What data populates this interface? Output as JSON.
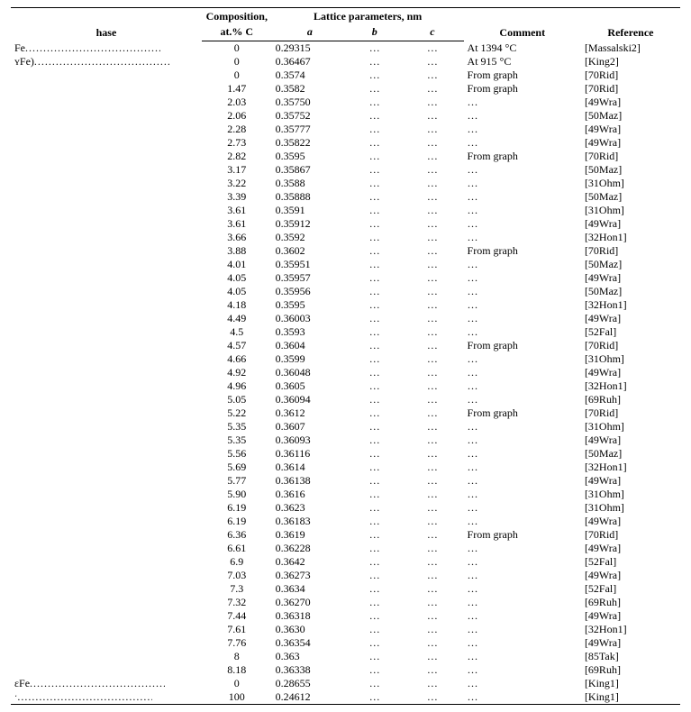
{
  "headers": {
    "phase": "hase",
    "composition_top": "Composition,",
    "composition_bot": "at.% C",
    "lattice": "Lattice parameters, nm",
    "a": "a",
    "b": "b",
    "c": "c",
    "comment": "Comment",
    "reference": "Reference"
  },
  "chart_data": {
    "type": "table",
    "columns": [
      "Phase",
      "Composition, at.% C",
      "a (nm)",
      "b (nm)",
      "c (nm)",
      "Comment",
      "Reference"
    ]
  },
  "rows": [
    {
      "phase": "Fe",
      "comp": "0",
      "a": "0.29315",
      "b": "…",
      "c": "…",
      "comment": "At 1394 °C",
      "ref": "[Massalski2]"
    },
    {
      "phase": "ʏFe)",
      "comp": "0",
      "a": "0.36467",
      "b": "…",
      "c": "…",
      "comment": "At 915 °C",
      "ref": "[King2]"
    },
    {
      "phase": "",
      "comp": "0",
      "a": "0.3574",
      "b": "…",
      "c": "…",
      "comment": "From graph",
      "ref": "[70Rid]"
    },
    {
      "phase": "",
      "comp": "1.47",
      "a": "0.3582",
      "b": "…",
      "c": "…",
      "comment": "From graph",
      "ref": "[70Rid]"
    },
    {
      "phase": "",
      "comp": "2.03",
      "a": "0.35750",
      "b": "…",
      "c": "…",
      "comment": "…",
      "ref": "[49Wra]"
    },
    {
      "phase": "",
      "comp": "2.06",
      "a": "0.35752",
      "b": "…",
      "c": "…",
      "comment": "…",
      "ref": "[50Maz]"
    },
    {
      "phase": "",
      "comp": "2.28",
      "a": "0.35777",
      "b": "…",
      "c": "…",
      "comment": "…",
      "ref": "[49Wra]"
    },
    {
      "phase": "",
      "comp": "2.73",
      "a": "0.35822",
      "b": "…",
      "c": "…",
      "comment": "…",
      "ref": "[49Wra]"
    },
    {
      "phase": "",
      "comp": "2.82",
      "a": "0.3595",
      "b": "…",
      "c": "…",
      "comment": "From graph",
      "ref": "[70Rid]"
    },
    {
      "phase": "",
      "comp": "3.17",
      "a": "0.35867",
      "b": "…",
      "c": "…",
      "comment": "…",
      "ref": "[50Maz]"
    },
    {
      "phase": "",
      "comp": "3.22",
      "a": "0.3588",
      "b": "…",
      "c": "…",
      "comment": "…",
      "ref": "[31Ohm]"
    },
    {
      "phase": "",
      "comp": "3.39",
      "a": "0.35888",
      "b": "…",
      "c": "…",
      "comment": "…",
      "ref": "[50Maz]"
    },
    {
      "phase": "",
      "comp": "3.61",
      "a": "0.3591",
      "b": "…",
      "c": "…",
      "comment": "…",
      "ref": "[31Ohm]"
    },
    {
      "phase": "",
      "comp": "3.61",
      "a": "0.35912",
      "b": "…",
      "c": "…",
      "comment": "…",
      "ref": "[49Wra]"
    },
    {
      "phase": "",
      "comp": "3.66",
      "a": "0.3592",
      "b": "…",
      "c": "…",
      "comment": "…",
      "ref": "[32Hon1]"
    },
    {
      "phase": "",
      "comp": "3.88",
      "a": "0.3602",
      "b": "…",
      "c": "…",
      "comment": "From graph",
      "ref": "[70Rid]"
    },
    {
      "phase": "",
      "comp": "4.01",
      "a": "0.35951",
      "b": "…",
      "c": "…",
      "comment": "…",
      "ref": "[50Maz]"
    },
    {
      "phase": "",
      "comp": "4.05",
      "a": "0.35957",
      "b": "…",
      "c": "…",
      "comment": "…",
      "ref": "[49Wra]"
    },
    {
      "phase": "",
      "comp": "4.05",
      "a": "0.35956",
      "b": "…",
      "c": "…",
      "comment": "…",
      "ref": "[50Maz]"
    },
    {
      "phase": "",
      "comp": "4.18",
      "a": "0.3595",
      "b": "…",
      "c": "…",
      "comment": "…",
      "ref": "[32Hon1]"
    },
    {
      "phase": "",
      "comp": "4.49",
      "a": "0.36003",
      "b": "…",
      "c": "…",
      "comment": "…",
      "ref": "[49Wra]"
    },
    {
      "phase": "",
      "comp": "4.5",
      "a": "0.3593",
      "b": "…",
      "c": "…",
      "comment": "…",
      "ref": "[52Fal]"
    },
    {
      "phase": "",
      "comp": "4.57",
      "a": "0.3604",
      "b": "…",
      "c": "…",
      "comment": "From graph",
      "ref": "[70Rid]"
    },
    {
      "phase": "",
      "comp": "4.66",
      "a": "0.3599",
      "b": "…",
      "c": "…",
      "comment": "…",
      "ref": "[31Ohm]"
    },
    {
      "phase": "",
      "comp": "4.92",
      "a": "0.36048",
      "b": "…",
      "c": "…",
      "comment": "…",
      "ref": "[49Wra]"
    },
    {
      "phase": "",
      "comp": "4.96",
      "a": "0.3605",
      "b": "…",
      "c": "…",
      "comment": "…",
      "ref": "[32Hon1]"
    },
    {
      "phase": "",
      "comp": "5.05",
      "a": "0.36094",
      "b": "…",
      "c": "…",
      "comment": "…",
      "ref": "[69Ruh]"
    },
    {
      "phase": "",
      "comp": "5.22",
      "a": "0.3612",
      "b": "…",
      "c": "…",
      "comment": "From graph",
      "ref": "[70Rid]"
    },
    {
      "phase": "",
      "comp": "5.35",
      "a": "0.3607",
      "b": "…",
      "c": "…",
      "comment": "…",
      "ref": "[31Ohm]"
    },
    {
      "phase": "",
      "comp": "5.35",
      "a": "0.36093",
      "b": "…",
      "c": "…",
      "comment": "…",
      "ref": "[49Wra]"
    },
    {
      "phase": "",
      "comp": "5.56",
      "a": "0.36116",
      "b": "…",
      "c": "…",
      "comment": "…",
      "ref": "[50Maz]"
    },
    {
      "phase": "",
      "comp": "5.69",
      "a": "0.3614",
      "b": "…",
      "c": "…",
      "comment": "…",
      "ref": "[32Hon1]"
    },
    {
      "phase": "",
      "comp": "5.77",
      "a": "0.36138",
      "b": "…",
      "c": "…",
      "comment": "…",
      "ref": "[49Wra]"
    },
    {
      "phase": "",
      "comp": "5.90",
      "a": "0.3616",
      "b": "…",
      "c": "…",
      "comment": "…",
      "ref": "[31Ohm]"
    },
    {
      "phase": "",
      "comp": "6.19",
      "a": "0.3623",
      "b": "…",
      "c": "…",
      "comment": "…",
      "ref": "[31Ohm]"
    },
    {
      "phase": "",
      "comp": "6.19",
      "a": "0.36183",
      "b": "…",
      "c": "…",
      "comment": "…",
      "ref": "[49Wra]"
    },
    {
      "phase": "",
      "comp": "6.36",
      "a": "0.3619",
      "b": "…",
      "c": "…",
      "comment": "From graph",
      "ref": "[70Rid]"
    },
    {
      "phase": "",
      "comp": "6.61",
      "a": "0.36228",
      "b": "…",
      "c": "…",
      "comment": "…",
      "ref": "[49Wra]"
    },
    {
      "phase": "",
      "comp": "6.9",
      "a": "0.3642",
      "b": "…",
      "c": "…",
      "comment": "…",
      "ref": "[52Fal]"
    },
    {
      "phase": "",
      "comp": "7.03",
      "a": "0.36273",
      "b": "…",
      "c": "…",
      "comment": "…",
      "ref": "[49Wra]"
    },
    {
      "phase": "",
      "comp": "7.3",
      "a": "0.3634",
      "b": "…",
      "c": "…",
      "comment": "…",
      "ref": "[52Fal]"
    },
    {
      "phase": "",
      "comp": "7.32",
      "a": "0.36270",
      "b": "…",
      "c": "…",
      "comment": "…",
      "ref": "[69Ruh]"
    },
    {
      "phase": "",
      "comp": "7.44",
      "a": "0.36318",
      "b": "…",
      "c": "…",
      "comment": "…",
      "ref": "[49Wra]"
    },
    {
      "phase": "",
      "comp": "7.61",
      "a": "0.3630",
      "b": "…",
      "c": "…",
      "comment": "…",
      "ref": "[32Hon1]"
    },
    {
      "phase": "",
      "comp": "7.76",
      "a": "0.36354",
      "b": "…",
      "c": "…",
      "comment": "…",
      "ref": "[49Wra]"
    },
    {
      "phase": "",
      "comp": "8",
      "a": "0.363",
      "b": "…",
      "c": "…",
      "comment": "…",
      "ref": "[85Tak]"
    },
    {
      "phase": "",
      "comp": "8.18",
      "a": "0.36338",
      "b": "…",
      "c": "…",
      "comment": "…",
      "ref": "[69Ruh]"
    },
    {
      "phase": "ɛFe",
      "comp": "0",
      "a": "0.28655",
      "b": "…",
      "c": "…",
      "comment": "…",
      "ref": "[King1]"
    },
    {
      "phase": "ˑ",
      "comp": "100",
      "a": "0.24612",
      "b": "…",
      "c": "…",
      "comment": "…",
      "ref": "[King1]"
    }
  ]
}
